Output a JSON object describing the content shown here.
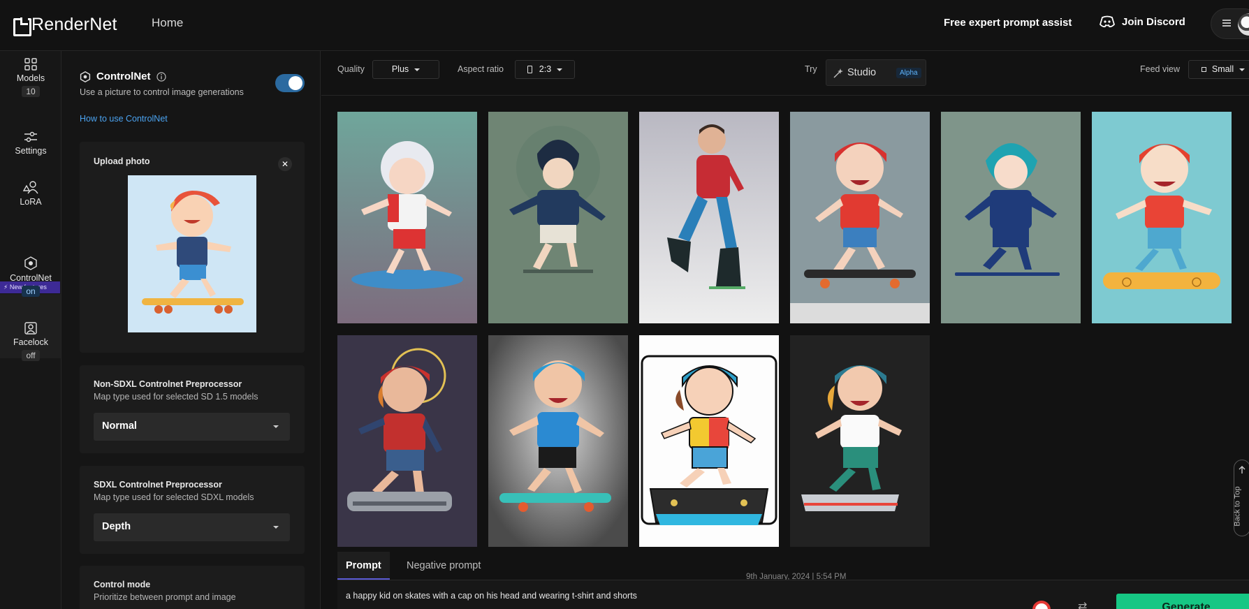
{
  "header": {
    "logo_text": "RenderNet",
    "nav_home": "Home",
    "prompt_assist": "Free expert prompt assist",
    "discord": "Join Discord"
  },
  "rail": {
    "models_label": "Models",
    "models_count": "10",
    "settings_label": "Settings",
    "lora_label": "LoRA",
    "new_features": "New features",
    "controlnet_label": "ControlNet",
    "controlnet_state": "on",
    "facelock_label": "Facelock",
    "facelock_state": "off"
  },
  "panel": {
    "title": "ControlNet",
    "subtitle": "Use a picture to control image generations",
    "how_link": "How to use ControlNet",
    "upload_title": "Upload photo",
    "non_sdxl_title": "Non-SDXL Controlnet Preprocessor",
    "non_sdxl_sub": "Map type used for selected SD 1.5 models",
    "non_sdxl_value": "Normal",
    "sdxl_title": "SDXL Controlnet Preprocessor",
    "sdxl_sub": "Map type used for selected SDXL models",
    "sdxl_value": "Depth",
    "control_title": "Control mode",
    "control_sub": "Prioritize between prompt and image"
  },
  "toolbar": {
    "quality_label": "Quality",
    "quality_value": "Plus",
    "aspect_label": "Aspect ratio",
    "aspect_value": "2:3",
    "try_label": "Try",
    "studio_label": "Studio",
    "alpha_badge": "Alpha",
    "feed_label": "Feed view",
    "feed_value": "Small"
  },
  "gallery": {
    "back_to_top": "Back to Top"
  },
  "prompt": {
    "tab_prompt": "Prompt",
    "tab_negative": "Negative prompt",
    "timestamp": "9th January, 2024 | 5:54 PM",
    "text": "a happy kid on skates with a cap on his head and wearing t-shirt and shorts",
    "generate": "Generate"
  }
}
